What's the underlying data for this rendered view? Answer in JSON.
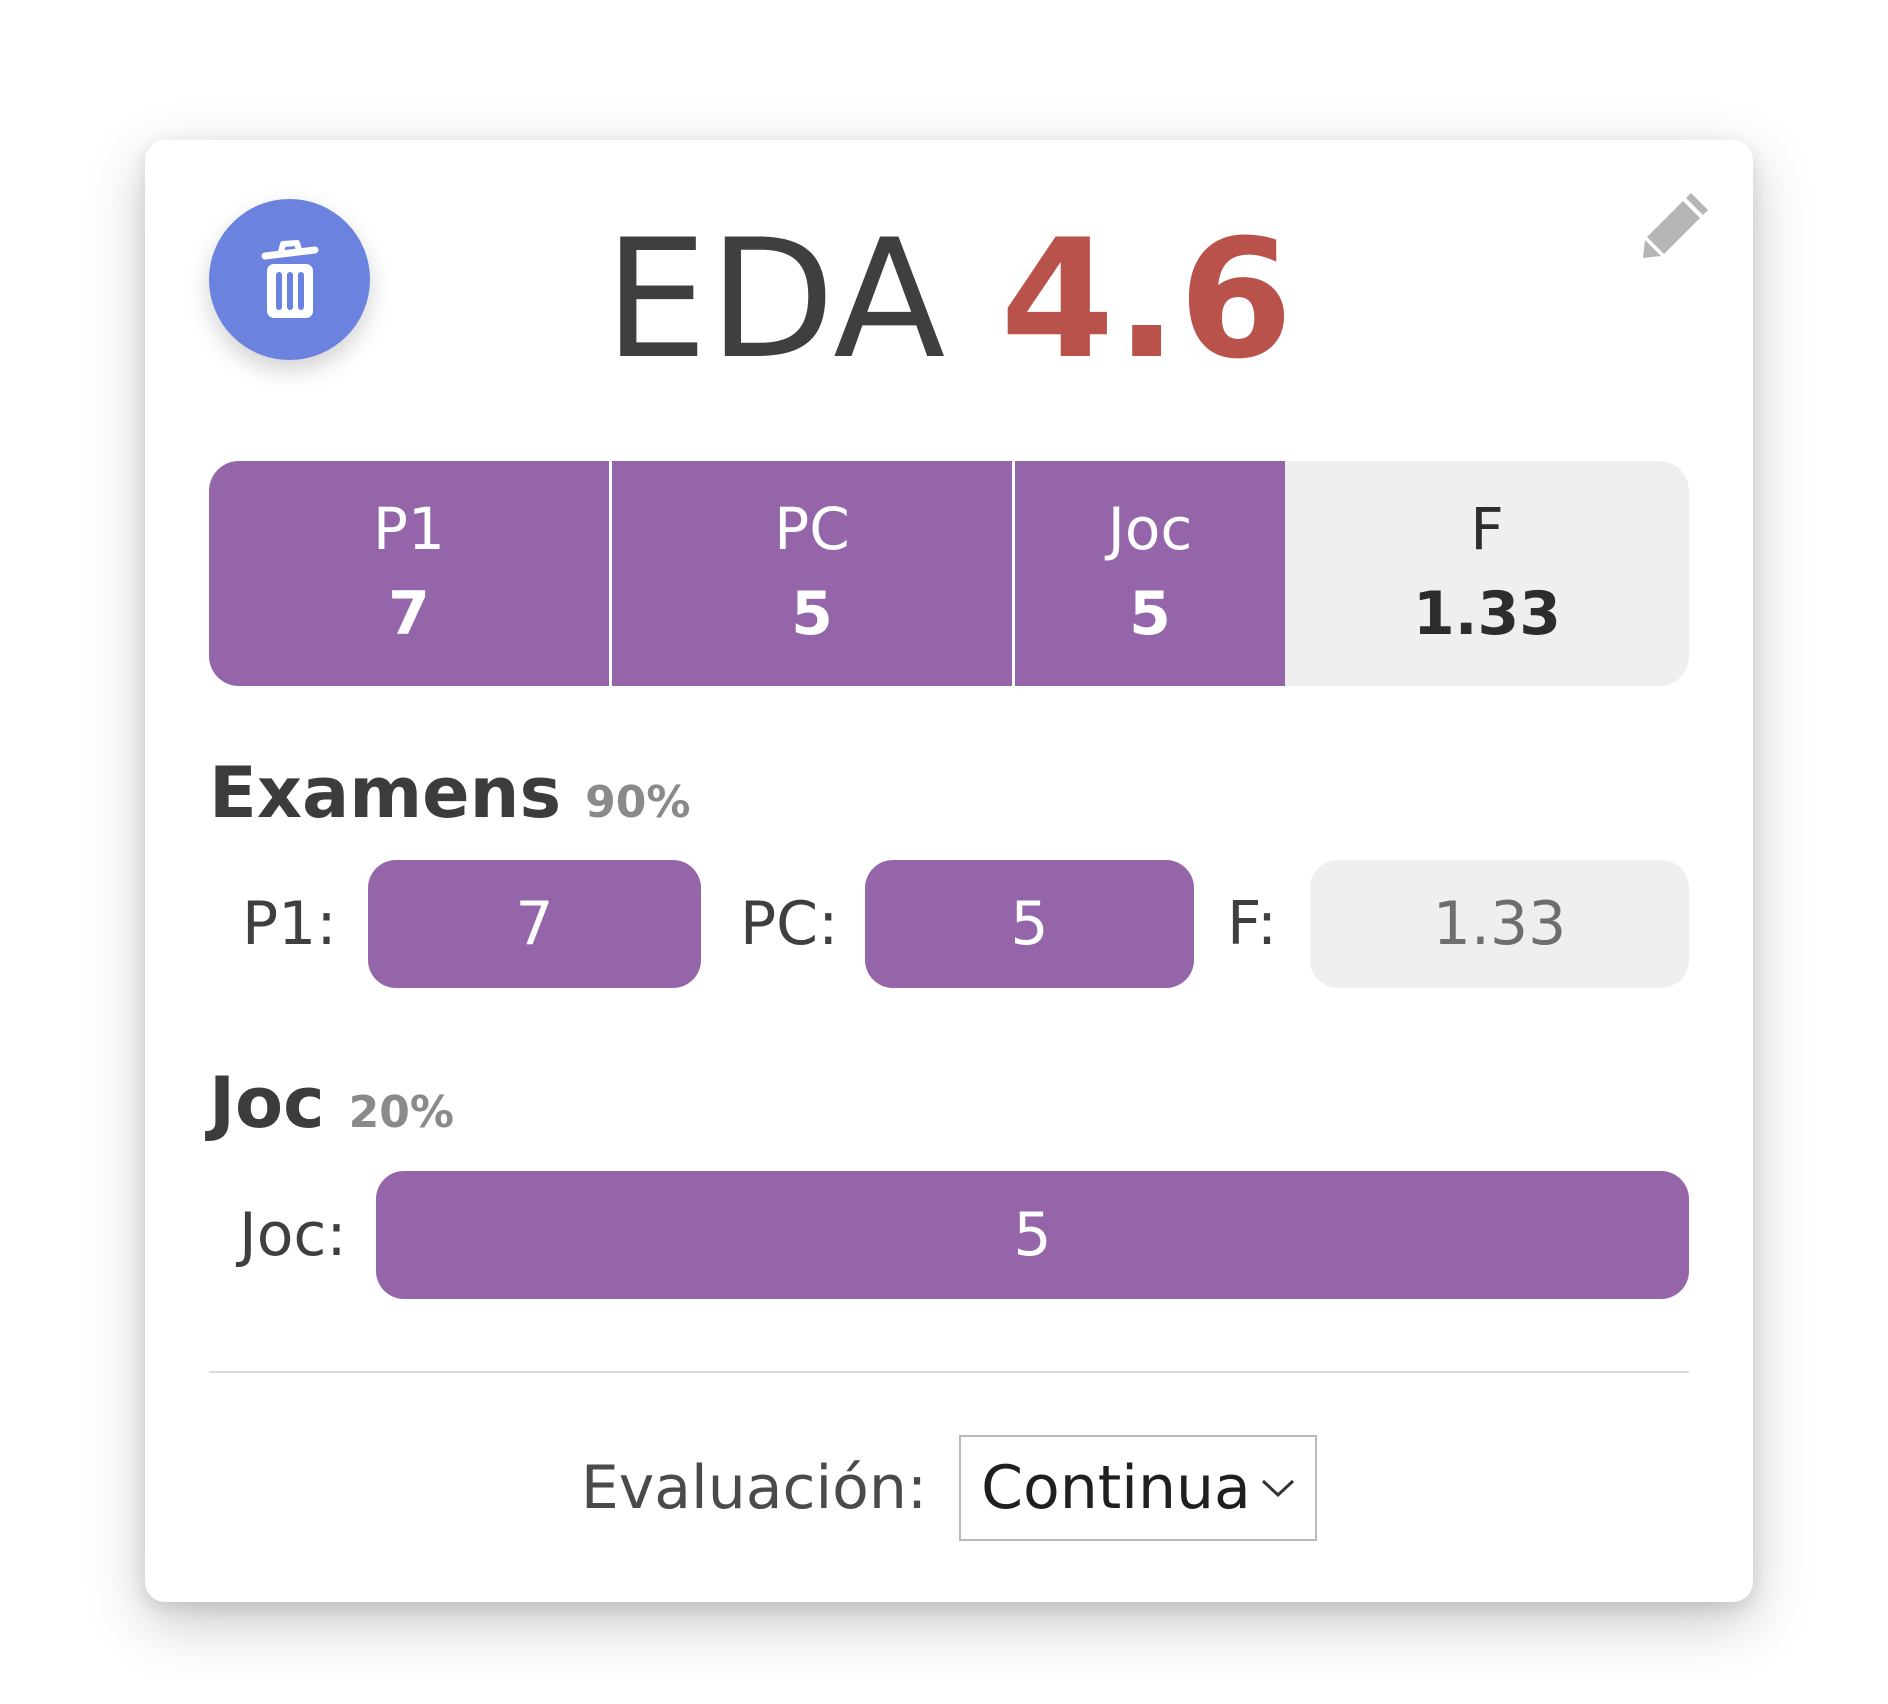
{
  "header": {
    "subject": "EDA",
    "grade": "4.6"
  },
  "colors": {
    "accent_purple": "#9466a9",
    "grade_red": "#b9524a",
    "delete_blue": "#6b82df",
    "neutral_grey": "#efefef"
  },
  "icons": {
    "delete": "trash-icon",
    "edit": "pencil-icon",
    "dropdown": "chevron-down-icon"
  },
  "summary": [
    {
      "label": "P1",
      "value": "7"
    },
    {
      "label": "PC",
      "value": "5"
    },
    {
      "label": "Joc",
      "value": "5"
    },
    {
      "label": "F",
      "value": "1.33"
    }
  ],
  "examens": {
    "title": "Examens",
    "weight": "90%",
    "fields": [
      {
        "label": "P1:",
        "value": "7"
      },
      {
        "label": "PC:",
        "value": "5"
      },
      {
        "label": "F:",
        "value": "1.33"
      }
    ]
  },
  "joc": {
    "title": "Joc",
    "weight": "20%",
    "fields": [
      {
        "label": "Joc:",
        "value": "5"
      }
    ]
  },
  "evaluation": {
    "label": "Evaluación:",
    "selected": "Continua"
  }
}
